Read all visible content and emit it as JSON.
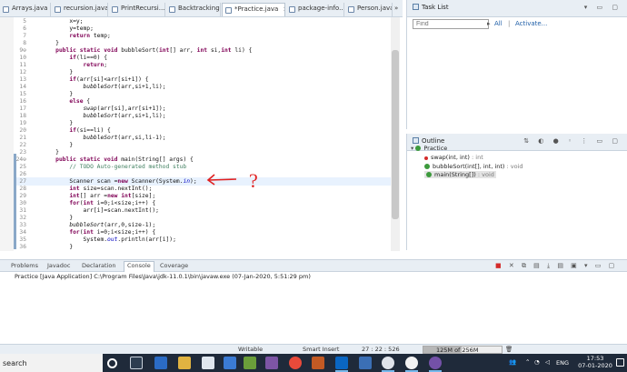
{
  "editor_tabs": [
    {
      "label": "Arrays.java",
      "active": false
    },
    {
      "label": "recursion.java",
      "active": false
    },
    {
      "label": "PrintRecursi...",
      "active": false
    },
    {
      "label": "Backtracking....",
      "active": false
    },
    {
      "label": "*Practice.java",
      "active": true
    },
    {
      "label": "package-info....",
      "active": false
    },
    {
      "label": "Person.java",
      "active": false
    }
  ],
  "overflow_indicator": "» ",
  "code_lines": [
    {
      "n": "5",
      "text": "        x=y;"
    },
    {
      "n": "6",
      "text": "        y=temp;"
    },
    {
      "n": "7",
      "text": "        return temp;"
    },
    {
      "n": "8",
      "text": "    }"
    },
    {
      "n": "9⊖",
      "text": "    public static void bubbleSort(int[] arr, int si,int li) {"
    },
    {
      "n": "10",
      "text": "        if(li==0) {"
    },
    {
      "n": "11",
      "text": "            return;"
    },
    {
      "n": "12",
      "text": "        }"
    },
    {
      "n": "13",
      "text": "        if(arr[si]<arr[si+1]) {"
    },
    {
      "n": "14",
      "text": "            bubbleSort(arr,si+1,li);"
    },
    {
      "n": "15",
      "text": "        }"
    },
    {
      "n": "16",
      "text": "        else {"
    },
    {
      "n": "17",
      "text": "            swap(arr[si],arr[si+1]);"
    },
    {
      "n": "18",
      "text": "            bubbleSort(arr,si+1,li);"
    },
    {
      "n": "19",
      "text": "        }"
    },
    {
      "n": "20",
      "text": "        if(si==li) {"
    },
    {
      "n": "21",
      "text": "            bubbleSort(arr,si,li-1);"
    },
    {
      "n": "22",
      "text": "        }"
    },
    {
      "n": "23",
      "text": "    }"
    },
    {
      "n": "24⊖",
      "text": "    public static void main(String[] args) {"
    },
    {
      "n": "25",
      "text": "        // TODO Auto-generated method stub"
    },
    {
      "n": "26",
      "text": ""
    },
    {
      "n": "27",
      "text": "        Scanner scan =new Scanner(System.in);"
    },
    {
      "n": "28",
      "text": "        int size=scan.nextInt();"
    },
    {
      "n": "29",
      "text": "        int[] arr =new int[size];"
    },
    {
      "n": "30",
      "text": "        for(int i=0;i<size;i++) {"
    },
    {
      "n": "31",
      "text": "            arr[i]=scan.nextInt();"
    },
    {
      "n": "32",
      "text": "        }"
    },
    {
      "n": "33",
      "text": "        bubbleSort(arr,0,size-1);"
    },
    {
      "n": "34",
      "text": "        for(int i=0;i<size;i++) {"
    },
    {
      "n": "35",
      "text": "            System.out.println(arr[i]);"
    },
    {
      "n": "36",
      "text": "        }"
    }
  ],
  "annotation": {
    "mark": "?"
  },
  "tasklist": {
    "title": "Task List",
    "find_placeholder": "Find",
    "all_label": "All",
    "activate_label": "Activate...",
    "close": "×"
  },
  "outline": {
    "title": "Outline",
    "class_name": "Practice",
    "methods": [
      {
        "name": "swap(int, int)",
        "ret": " : int"
      },
      {
        "name": "bubbleSort(int[], int, int)",
        "ret": " : void"
      },
      {
        "name": "main(String[])",
        "ret": " : void"
      }
    ]
  },
  "console": {
    "tabs": [
      "Problems",
      "Javadoc",
      "Declaration",
      "Console",
      "Coverage"
    ],
    "active_tab": "Console",
    "message": "Practice [Java Application] C:\\Program Files\\Java\\jdk-11.0.1\\bin\\javaw.exe (07-Jan-2020, 5:51:29 pm)"
  },
  "status": {
    "mode": "Writable",
    "insert": "Smart Insert",
    "position": "27 : 22 : 526",
    "heap": "125M of 256M",
    "heap_fraction": 0.49
  },
  "taskbar": {
    "search": "search",
    "lang": "ENG",
    "time": "17:53",
    "date": "07-01-2020"
  },
  "colors": {
    "accent": "#1f5fa8",
    "keyword": "#7f0055",
    "comment": "#3f7f5f",
    "annotation_red": "#e02020",
    "taskbar": "#1f2a3a"
  }
}
